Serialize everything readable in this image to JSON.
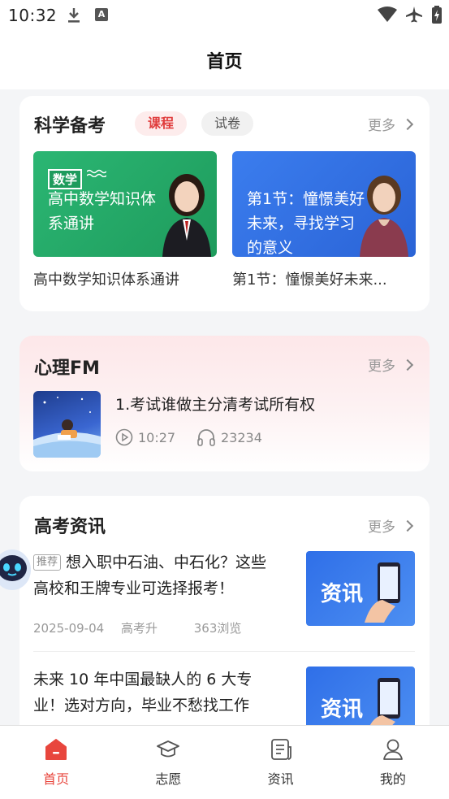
{
  "status_bar": {
    "time": "10:32",
    "a_icon": "A"
  },
  "header": {
    "title": "首页"
  },
  "exam_section": {
    "title": "科学备考",
    "tabs": [
      {
        "label": "课程",
        "active": true
      },
      {
        "label": "试卷",
        "active": false
      }
    ],
    "more": "更多",
    "courses": [
      {
        "tag": "数学",
        "image_text": "高中数学知识体系通讲",
        "caption": "高中数学知识体系通讲"
      },
      {
        "image_text": "第1节：憧憬美好未来，寻找学习的意义",
        "caption": "第1节：憧憬美好未来..."
      }
    ]
  },
  "fm_section": {
    "title": "心理FM",
    "more": "更多",
    "item": {
      "title": "1.考试谁做主分清考试所有权",
      "duration": "10:27",
      "listens": "23234"
    }
  },
  "news_section": {
    "title": "高考资讯",
    "more": "更多",
    "items": [
      {
        "tag": "推荐",
        "title": "想入职中石油、中石化？这些高校和王牌专业可选择报考！",
        "date": "2025-09-04",
        "source": "高考升",
        "views": "363浏览",
        "image_word": "资讯"
      },
      {
        "title": "未来 10 年中国最缺人的 6 大专业！选对方向，毕业不愁找工作",
        "image_word": "资讯"
      }
    ]
  },
  "bottom_nav": [
    {
      "label": "首页",
      "icon": "home-icon",
      "active": true
    },
    {
      "label": "志愿",
      "icon": "graduation-cap-icon",
      "active": false
    },
    {
      "label": "资讯",
      "icon": "news-icon",
      "active": false
    },
    {
      "label": "我的",
      "icon": "user-icon",
      "active": false
    }
  ],
  "colors": {
    "accent": "#e8463d",
    "course_green": "#2bb673",
    "course_blue": "#3b7dee"
  }
}
